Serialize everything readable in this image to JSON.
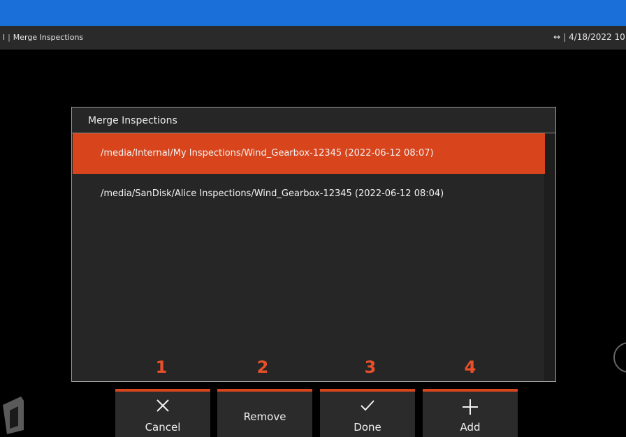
{
  "titlebar": {
    "left_marker": "l",
    "title": "Merge Inspections",
    "arrows_icon": "↔",
    "date": "4/18/2022 10"
  },
  "dialog": {
    "title": "Merge Inspections",
    "items": [
      {
        "path": "/media/Internal/My Inspections/Wind_Gearbox-12345 (2022-06-12 08:07)",
        "selected": true
      },
      {
        "path": "/media/SanDisk/Alice Inspections/Wind_Gearbox-12345 (2022-06-12 08:04)",
        "selected": false
      }
    ]
  },
  "callouts": [
    "1",
    "2",
    "3",
    "4"
  ],
  "softkeys": [
    {
      "label": "Cancel",
      "icon": "x-icon"
    },
    {
      "label": "Remove",
      "icon": ""
    },
    {
      "label": "Done",
      "icon": "check-icon"
    },
    {
      "label": "Add",
      "icon": "plus-icon"
    }
  ],
  "colors": {
    "accent": "#d8451d",
    "top_bar": "#1a6fd8",
    "callout": "#e8502a"
  }
}
